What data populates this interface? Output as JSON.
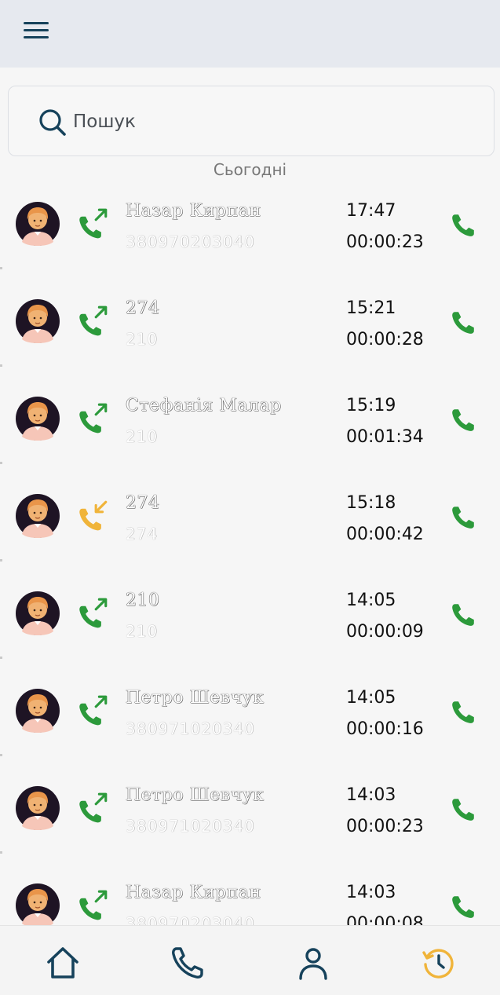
{
  "header": {
    "menu_icon": "hamburger-menu-icon"
  },
  "search": {
    "placeholder": "Пошук",
    "value": ""
  },
  "section_label": "Сьогодні",
  "colors": {
    "outgoing": "#2c9a3b",
    "incoming": "#f0b43a",
    "nav_icon": "#16425b",
    "nav_active": "#f0b43a",
    "header_bg": "#e6e9ef"
  },
  "calls": [
    {
      "name": "Назар Кирпан",
      "sub": "380970203040",
      "time": "17:47",
      "duration": "00:00:23",
      "direction": "outgoing"
    },
    {
      "name": "274",
      "sub": "210",
      "time": "15:21",
      "duration": "00:00:28",
      "direction": "outgoing"
    },
    {
      "name": "Стефанія Малар",
      "sub": "210",
      "time": "15:19",
      "duration": "00:01:34",
      "direction": "outgoing"
    },
    {
      "name": "274",
      "sub": "274",
      "time": "15:18",
      "duration": "00:00:42",
      "direction": "incoming"
    },
    {
      "name": "210",
      "sub": "210",
      "time": "14:05",
      "duration": "00:00:09",
      "direction": "outgoing"
    },
    {
      "name": "Петро Шевчук",
      "sub": "380971020340",
      "time": "14:05",
      "duration": "00:00:16",
      "direction": "outgoing"
    },
    {
      "name": "Петро Шевчук",
      "sub": "380971020340",
      "time": "14:03",
      "duration": "00:00:23",
      "direction": "outgoing"
    },
    {
      "name": "Назар Кирпан",
      "sub": "380970203040",
      "time": "14:03",
      "duration": "00:00:08",
      "direction": "outgoing"
    }
  ],
  "bottom_nav": [
    {
      "icon": "home-icon",
      "active": false
    },
    {
      "icon": "phone-icon",
      "active": false
    },
    {
      "icon": "contacts-icon",
      "active": false
    },
    {
      "icon": "history-icon",
      "active": true
    }
  ]
}
